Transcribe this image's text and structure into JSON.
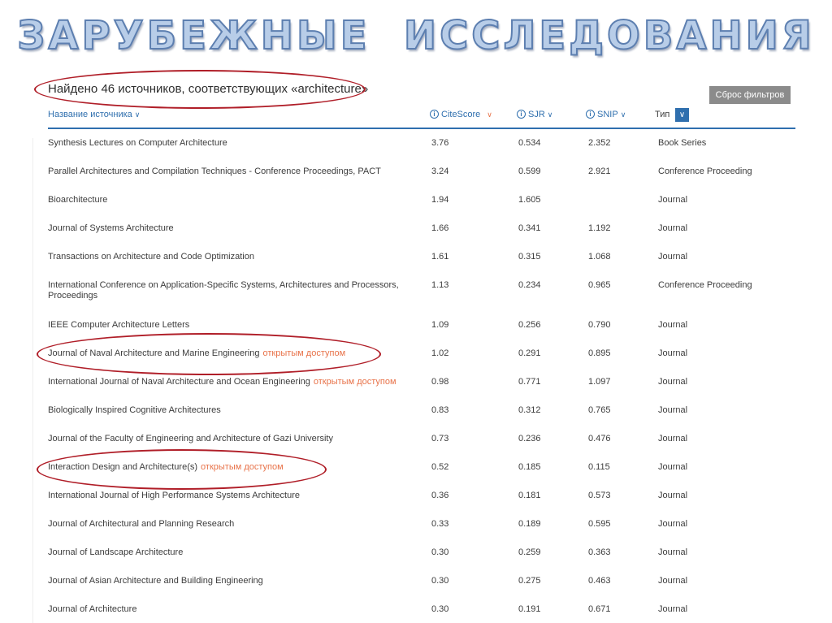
{
  "slide": {
    "title": "ЗАРУБЕЖНЫЕ  ИССЛЕДОВАНИЯ"
  },
  "search": {
    "results_text": "Найдено 46 источников, соответствующих «architecture»",
    "reset_label": "Сброс фильтров"
  },
  "table": {
    "headers": {
      "name": "Название источника",
      "citescore": "CiteScore",
      "sjr": "SJR",
      "snip": "SNIP",
      "type": "Тип"
    },
    "open_access_label": "открытым доступом",
    "rows": [
      {
        "name": "Synthesis Lectures on Computer Architecture",
        "citescore": "3.76",
        "sjr": "0.534",
        "snip": "2.352",
        "type": "Book Series",
        "open_access": ""
      },
      {
        "name": "Parallel Architectures and Compilation Techniques - Conference Proceedings, PACT",
        "citescore": "3.24",
        "sjr": "0.599",
        "snip": "2.921",
        "type": "Conference Proceeding",
        "open_access": ""
      },
      {
        "name": "Bioarchitecture",
        "citescore": "1.94",
        "sjr": "1.605",
        "snip": "",
        "type": "Journal",
        "open_access": ""
      },
      {
        "name": "Journal of Systems Architecture",
        "citescore": "1.66",
        "sjr": "0.341",
        "snip": "1.192",
        "type": "Journal",
        "open_access": ""
      },
      {
        "name": "Transactions on Architecture and Code Optimization",
        "citescore": "1.61",
        "sjr": "0.315",
        "snip": "1.068",
        "type": "Journal",
        "open_access": ""
      },
      {
        "name": "International Conference on Application-Specific Systems, Architectures and Processors, Proceedings",
        "citescore": "1.13",
        "sjr": "0.234",
        "snip": "0.965",
        "type": "Conference Proceeding",
        "open_access": ""
      },
      {
        "name": "IEEE Computer Architecture Letters",
        "citescore": "1.09",
        "sjr": "0.256",
        "snip": "0.790",
        "type": "Journal",
        "open_access": ""
      },
      {
        "name": "Journal of Naval Architecture and Marine Engineering",
        "citescore": "1.02",
        "sjr": "0.291",
        "snip": "0.895",
        "type": "Journal",
        "open_access": "открытым доступом"
      },
      {
        "name": "International Journal of Naval Architecture and Ocean Engineering",
        "citescore": "0.98",
        "sjr": "0.771",
        "snip": "1.097",
        "type": "Journal",
        "open_access": "открытым доступом"
      },
      {
        "name": "Biologically Inspired Cognitive Architectures",
        "citescore": "0.83",
        "sjr": "0.312",
        "snip": "0.765",
        "type": "Journal",
        "open_access": ""
      },
      {
        "name": "Journal of the Faculty of Engineering and Architecture of Gazi University",
        "citescore": "0.73",
        "sjr": "0.236",
        "snip": "0.476",
        "type": "Journal",
        "open_access": ""
      },
      {
        "name": "Interaction Design and Architecture(s)",
        "citescore": "0.52",
        "sjr": "0.185",
        "snip": "0.115",
        "type": "Journal",
        "open_access": "открытым доступом"
      },
      {
        "name": "International Journal of High Performance Systems Architecture",
        "citescore": "0.36",
        "sjr": "0.181",
        "snip": "0.573",
        "type": "Journal",
        "open_access": ""
      },
      {
        "name": "Journal of Architectural and Planning Research",
        "citescore": "0.33",
        "sjr": "0.189",
        "snip": "0.595",
        "type": "Journal",
        "open_access": ""
      },
      {
        "name": "Journal of Landscape Architecture",
        "citescore": "0.30",
        "sjr": "0.259",
        "snip": "0.363",
        "type": "Journal",
        "open_access": ""
      },
      {
        "name": "Journal of Asian Architecture and Building Engineering",
        "citescore": "0.30",
        "sjr": "0.275",
        "snip": "0.463",
        "type": "Journal",
        "open_access": ""
      },
      {
        "name": "Journal of Architecture",
        "citescore": "0.30",
        "sjr": "0.191",
        "snip": "0.671",
        "type": "Journal",
        "open_access": ""
      }
    ]
  },
  "icons": {
    "info": "info-circle-icon",
    "sort": "chevron-down-icon",
    "filter": "filter-chevron-icon"
  },
  "colors": {
    "accent": "#2f6fae",
    "open_access": "#e8734a",
    "annotation": "#b01e28",
    "title_fill": "#b8cde8"
  }
}
